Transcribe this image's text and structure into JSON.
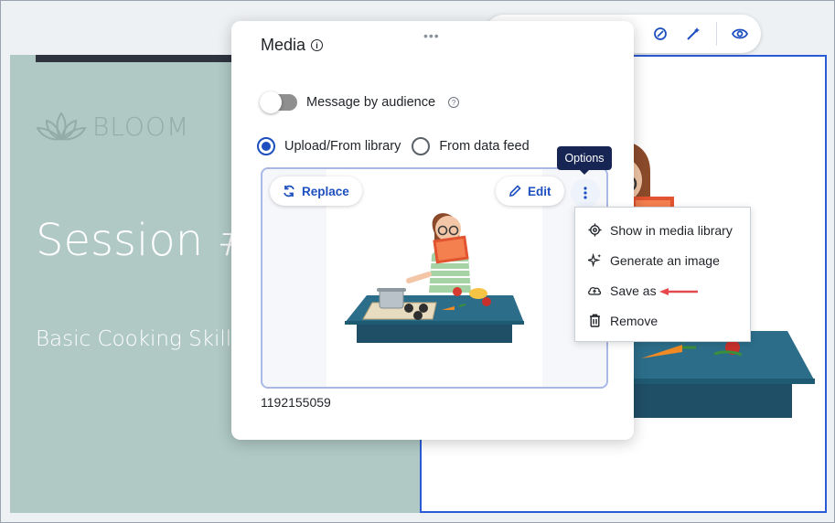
{
  "panel": {
    "title": "Media",
    "message_by_audience_label": "Message by audience",
    "source_options": [
      {
        "label": "Upload/From library",
        "selected": true
      },
      {
        "label": "From data feed",
        "selected": false
      }
    ],
    "replace_label": "Replace",
    "edit_label": "Edit",
    "file_name": "1192155059"
  },
  "tooltip": {
    "text": "Options"
  },
  "options_menu": {
    "items": [
      {
        "label": "Show in media library",
        "icon": "target-icon"
      },
      {
        "label": "Generate an image",
        "icon": "sparkle-icon"
      },
      {
        "label": "Save as",
        "icon": "cloud-upload-icon"
      },
      {
        "label": "Remove",
        "icon": "trash-icon"
      }
    ]
  },
  "canvas": {
    "logo_text": "BLOOM",
    "session_title": "Session #",
    "session_subtitle": "Basic Cooking Skills"
  },
  "colors": {
    "accent": "#1d4fbf",
    "slide_bg": "#b0c9c4",
    "tooltip_bg": "#172554",
    "annotation_arrow": "#e5484d"
  }
}
